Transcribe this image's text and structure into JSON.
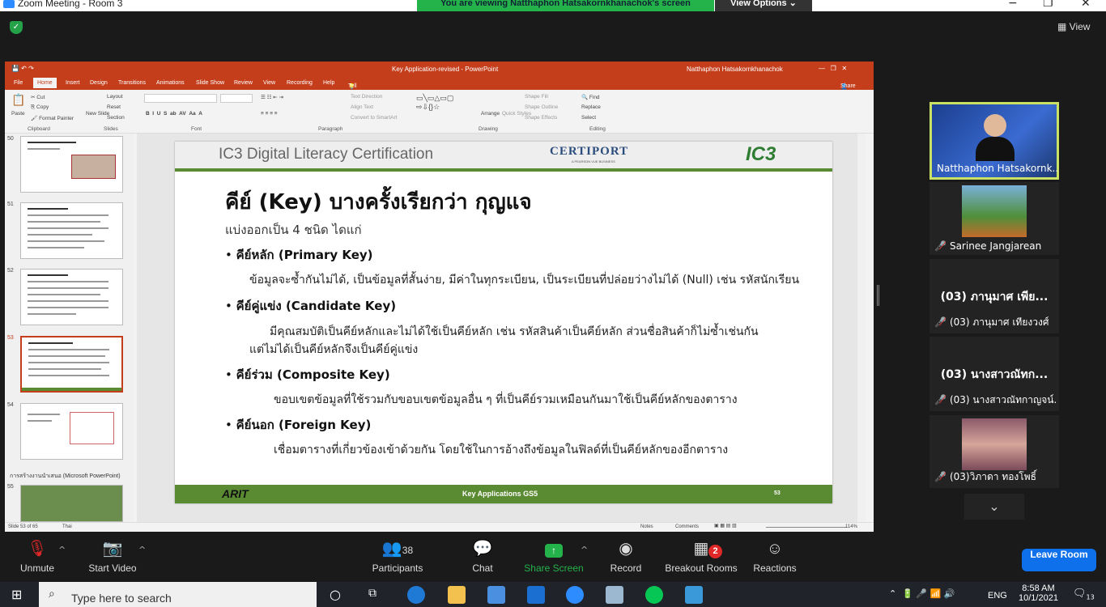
{
  "window": {
    "title": "Zoom Meeting - Room 3",
    "viewing_banner": "You are viewing Natthaphon Hatsakornkhanachok's screen",
    "view_options": "View Options"
  },
  "top_right": {
    "view_label": "View"
  },
  "ppt": {
    "title": "Key Application-revised - PowerPoint",
    "user": "Natthaphon Hatsakornkhanachok",
    "tabs": [
      "File",
      "Home",
      "Insert",
      "Design",
      "Transitions",
      "Animations",
      "Slide Show",
      "Review",
      "View",
      "Recording",
      "Help"
    ],
    "tell_me": "Tell me what you want to do",
    "share": "Share",
    "ribbon": {
      "paste": "Paste",
      "cut": "Cut",
      "copy": "Copy",
      "format_painter": "Format Painter",
      "clipboard": "Clipboard",
      "new_slide": "New Slide",
      "layout": "Layout",
      "reset": "Reset",
      "section": "Section",
      "slides": "Slides",
      "font": "Font",
      "paragraph": "Paragraph",
      "text_direction": "Text Direction",
      "align_text": "Align Text",
      "convert_smartart": "Convert to SmartArt",
      "arrange": "Arrange",
      "quick_styles": "Quick Styles",
      "shape_fill": "Shape Fill",
      "shape_outline": "Shape Outline",
      "shape_effects": "Shape Effects",
      "drawing": "Drawing",
      "find": "Find",
      "replace": "Replace",
      "select": "Select",
      "editing": "Editing"
    },
    "thumbnails": [
      {
        "num": "50"
      },
      {
        "num": "51"
      },
      {
        "num": "52"
      },
      {
        "num": "53"
      },
      {
        "num": "54"
      },
      {
        "num": "55"
      }
    ],
    "section_label": "การสร้างงานนำเสนอ (Microsoft PowerPoint)",
    "slide": {
      "header_title": "IC3 Digital Literacy Certification",
      "certiport": "CERTIPORT",
      "certiport_sub": "A PEARSON VUE BUSINESS",
      "ic3": "IC3",
      "heading": "คีย์ (Key) บางครั้งเรียกว่า กุญแจ",
      "subheading": "แบ่งออกเป็น 4 ชนิด ไดแก่",
      "bullets": [
        {
          "title": "คีย์หลัก (Primary Key)",
          "desc": "ข้อมูลจะซ้ำกันไม่ได้, เป็นข้อมูลที่สั้นง่าย, มีค่าในทุกระเบียน, เป็นระเบียนที่ปล่อยว่างไม่ได้ (Null) เช่น รหัสนักเรียน"
        },
        {
          "title": "คีย์คู่แข่ง (Candidate Key)",
          "desc": "มีคุณสมบัติเป็นคีย์หลักและไม่ได้ใช้เป็นคีย์หลัก เช่น รหัสสินค้าเป็นคีย์หลัก ส่วนชื่อสินค้าก็ไม่ซ้ำเช่นกัน",
          "desc2": "แต่ไม่ได้เป็นคีย์หลักจึงเป็นคีย์คู่แข่ง"
        },
        {
          "title": "คีย์ร่วม (Composite Key)",
          "desc": "ขอบเขตข้อมูลที่ใช้รวมกับขอบเขตข้อมูลอื่น ๆ ที่เป็นคีย์รวมเหมือนกันมาใช้เป็นคีย์หลักของตาราง"
        },
        {
          "title": "คีย์นอก (Foreign Key)",
          "desc": "เชื่อมตารางที่เกี่ยวข้องเข้าด้วยกัน โดยใช้ในการอ้างถึงข้อมูลในฟิลด์ที่เป็นคีย์หลักของอีกตาราง"
        }
      ],
      "footer_logo": "ARIT",
      "footer_title": "Key Applications GS5",
      "footer_page": "53"
    },
    "status": {
      "slide_count": "Slide 53 of 65",
      "language": "Thai",
      "notes": "Notes",
      "comments": "Comments",
      "zoom": "114%"
    }
  },
  "participants_panel": [
    {
      "name": "Natthaphon Hatsakornk...",
      "muted": false,
      "video": true
    },
    {
      "name": "Sarinee Jangjarean",
      "muted": true,
      "video": true
    },
    {
      "name": "(03) ภานุมาศ เทียงวงศ์",
      "display": "(03) ภานุมาศ เพีย...",
      "muted": true,
      "video": false
    },
    {
      "name": "(03) นางสาวณัทกาญจน์...",
      "display": "(03) นางสาวณัทก...",
      "muted": true,
      "video": false
    },
    {
      "name": "(03)วิภาดา ทองโพธิ์",
      "muted": true,
      "video": true
    }
  ],
  "toolbar": {
    "unmute": "Unmute",
    "start_video": "Start Video",
    "participants": "Participants",
    "participant_count": "38",
    "chat": "Chat",
    "share_screen": "Share Screen",
    "record": "Record",
    "breakout_rooms": "Breakout Rooms",
    "breakout_badge": "2",
    "reactions": "Reactions",
    "leave_room": "Leave Room"
  },
  "taskbar": {
    "search_placeholder": "Type here to search",
    "lang": "ENG",
    "time": "8:58 AM",
    "date": "10/1/2021",
    "notif_count": "13"
  },
  "colors": {
    "ppt_red": "#c43e1c",
    "slide_green": "#5a8a32",
    "zoom_blue": "#0e71eb",
    "share_green": "#24b24b",
    "active_speaker": "#c9e265"
  }
}
